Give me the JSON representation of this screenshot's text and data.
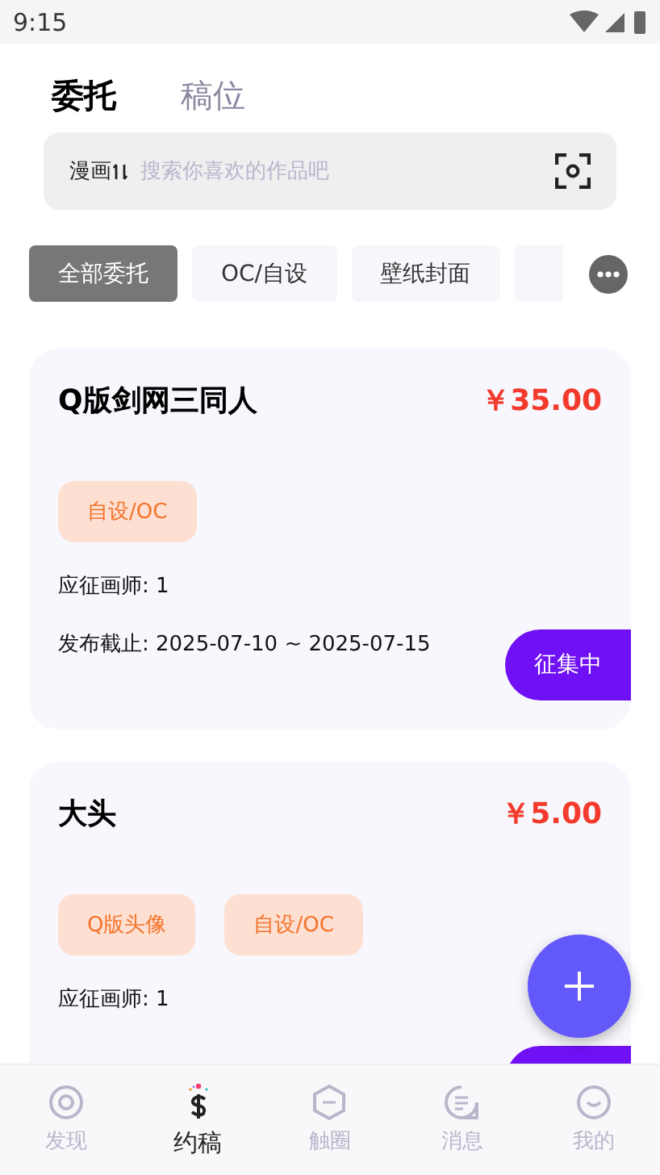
{
  "status_bar": {
    "time": "9:15"
  },
  "top_tabs": [
    {
      "label": "委托",
      "selected": true
    },
    {
      "label": "稿位",
      "selected": false
    }
  ],
  "search": {
    "category": "漫画",
    "placeholder": "搜索你喜欢的作品吧"
  },
  "filters": [
    {
      "label": "全部委托",
      "selected": true
    },
    {
      "label": "OC/自设",
      "selected": false
    },
    {
      "label": "壁纸封面",
      "selected": false
    },
    {
      "selected": false
    }
  ],
  "cards": [
    {
      "title": "Q版剑网三同人",
      "price": "￥35.00",
      "tags": [
        "自设/OC"
      ],
      "applicants": "应征画师: 1",
      "deadline": "发布截止: 2025-07-10 ~ 2025-07-15",
      "status": "征集中"
    },
    {
      "title": "大头",
      "price": "￥5.00",
      "tags": [
        "Q版头像",
        "自设/OC"
      ],
      "applicants": "应征画师: 1",
      "status_peek": true
    }
  ],
  "nav": [
    {
      "label": "发现",
      "kind": "discover",
      "selected": false
    },
    {
      "label": "约稿",
      "kind": "commission",
      "selected": true
    },
    {
      "label": "触圈",
      "kind": "circle",
      "selected": false
    },
    {
      "label": "消息",
      "kind": "message",
      "selected": false
    },
    {
      "label": "我的",
      "kind": "me",
      "selected": false
    }
  ]
}
